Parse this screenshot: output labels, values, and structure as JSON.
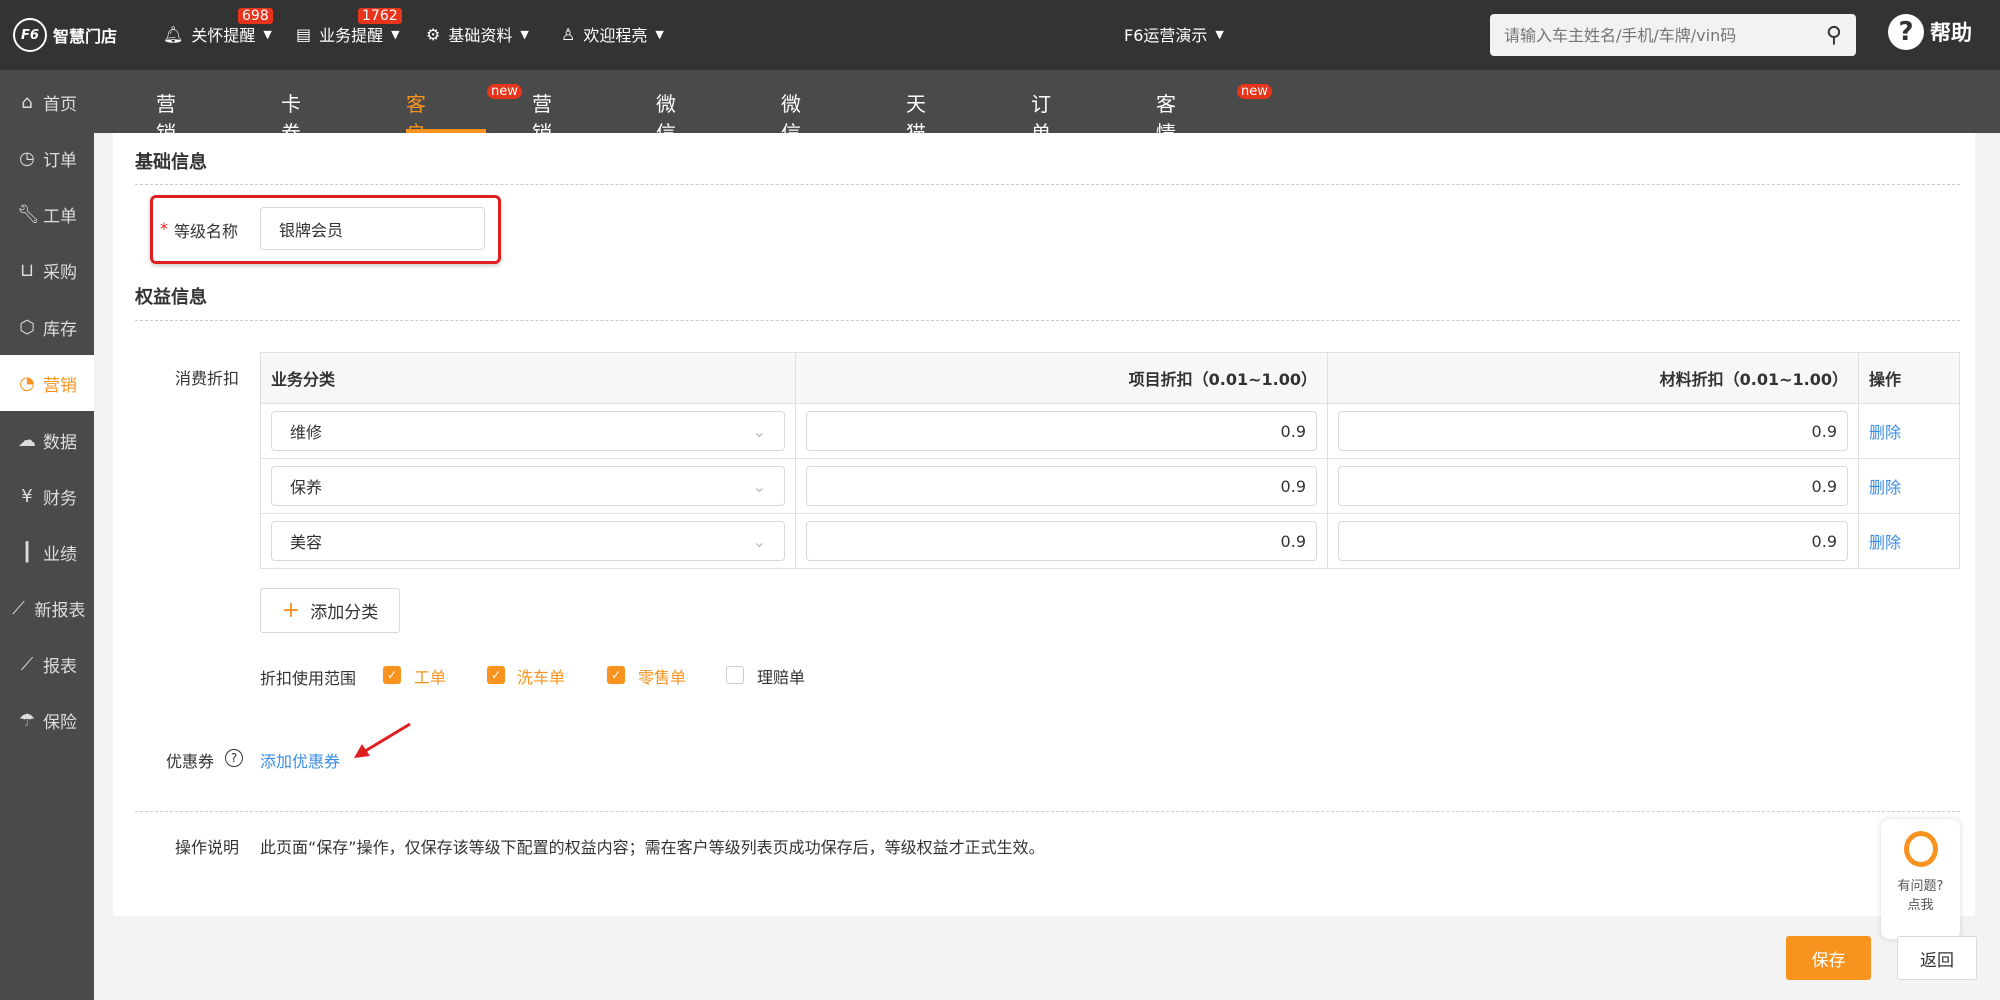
{
  "topbar": {
    "logo": "智慧门店",
    "items": [
      {
        "label": "关怀提醒",
        "badge": "698",
        "icon": "bell-icon"
      },
      {
        "label": "业务提醒",
        "badge": "1762",
        "icon": "document-icon"
      },
      {
        "label": "基础资料",
        "icon": "gear-icon"
      },
      {
        "label": "欢迎程亮",
        "icon": "user-icon"
      }
    ],
    "store": "F6运营演示",
    "search_placeholder": "请输入车主姓名/手机/车牌/vin码",
    "help": "帮助"
  },
  "sidebar": {
    "items": [
      {
        "label": "首页",
        "icon": "home-icon"
      },
      {
        "label": "订单",
        "icon": "clock-icon"
      },
      {
        "label": "工单",
        "icon": "wrench-icon"
      },
      {
        "label": "采购",
        "icon": "cart-icon"
      },
      {
        "label": "库存",
        "icon": "box-icon"
      },
      {
        "label": "营销",
        "icon": "pie-icon",
        "active": true
      },
      {
        "label": "数据",
        "icon": "cloud-icon"
      },
      {
        "label": "财务",
        "icon": "yen-icon"
      },
      {
        "label": "业绩",
        "icon": "bar-chart-icon"
      },
      {
        "label": "新报表",
        "icon": "line-chart-icon"
      },
      {
        "label": "报表",
        "icon": "line-chart-icon"
      },
      {
        "label": "保险",
        "icon": "umbrella-icon"
      }
    ]
  },
  "nav": {
    "tabs": [
      {
        "label": "营销看板"
      },
      {
        "label": "卡券积分"
      },
      {
        "label": "客户等级",
        "active": true,
        "badge": "new"
      },
      {
        "label": "营销活动"
      },
      {
        "label": "微信商城"
      },
      {
        "label": "微信管理"
      },
      {
        "label": "天猫管理"
      },
      {
        "label": "订单评价"
      },
      {
        "label": "客情维护",
        "badge": "new"
      }
    ]
  },
  "basic": {
    "title": "基础信息",
    "required_mark": "*",
    "name_label": "等级名称",
    "name_value": "银牌会员"
  },
  "rights": {
    "title": "权益信息",
    "discount_label": "消费折扣",
    "headers": [
      "业务分类",
      "项目折扣（0.01~1.00）",
      "材料折扣（0.01~1.00）",
      "操作"
    ],
    "rows": [
      {
        "category": "维修",
        "item": "0.9",
        "material": "0.9",
        "action": "删除"
      },
      {
        "category": "保养",
        "item": "0.9",
        "material": "0.9",
        "action": "删除"
      },
      {
        "category": "美容",
        "item": "0.9",
        "material": "0.9",
        "action": "删除"
      }
    ],
    "add_category": "添加分类",
    "scope_label": "折扣使用范围",
    "scope": [
      {
        "label": "工单",
        "checked": true
      },
      {
        "label": "洗车单",
        "checked": true
      },
      {
        "label": "零售单",
        "checked": true
      },
      {
        "label": "理赔单",
        "checked": false
      }
    ],
    "coupon_label": "优惠券",
    "coupon_link": "添加优惠券"
  },
  "note": {
    "label": "操作说明",
    "text": "此页面“保存”操作，仅保存该等级下配置的权益内容；需在客户等级列表页成功保存后，等级权益才正式生效。"
  },
  "help_widget": {
    "line1": "有问题?",
    "line2": "点我"
  },
  "footer": {
    "save": "保存",
    "back": "返回"
  },
  "colors": {
    "accent": "#f7931e",
    "link": "#3a8ee6",
    "badge": "#e8341c",
    "highlight": "#e02020"
  }
}
